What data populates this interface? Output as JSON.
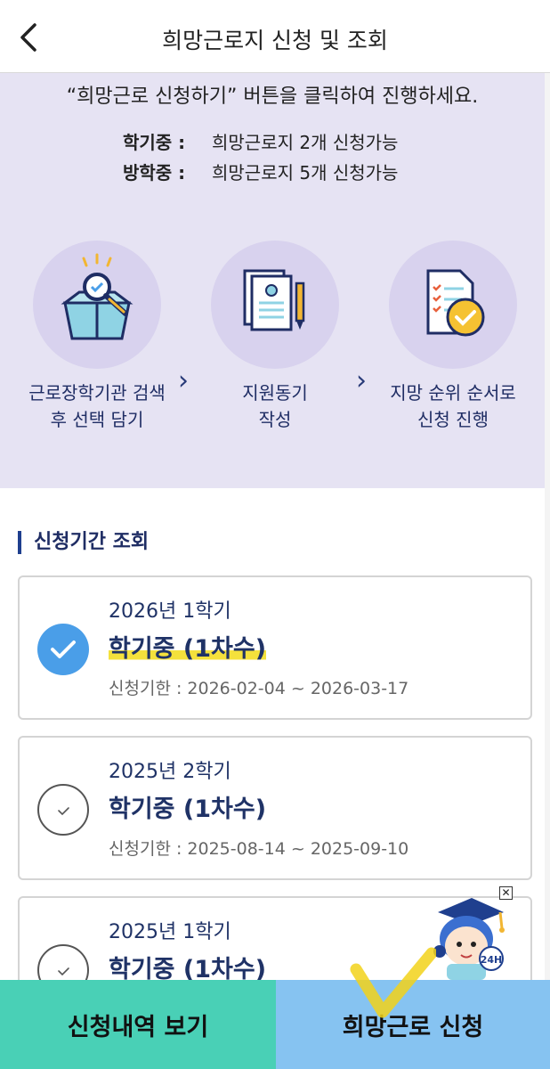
{
  "header": {
    "title": "희망근로지 신청 및 조회"
  },
  "info": {
    "message": "“희망근로 신청하기” 버튼을 클릭하여 진행하세요.",
    "capacity": [
      {
        "label": "학기중 :",
        "value": "희망근로지 2개 신청가능"
      },
      {
        "label": "방학중 :",
        "value": "희망근로지 5개 신청가능"
      }
    ],
    "steps": [
      {
        "icon": "search-box-icon",
        "label_line1": "근로장학기관 검색",
        "label_line2": "후 선택 담기"
      },
      {
        "icon": "document-pen-icon",
        "label_line1": "지원동기",
        "label_line2": "작성"
      },
      {
        "icon": "checklist-approved-icon",
        "label_line1": "지망 순위 순서로",
        "label_line2": "신청 진행"
      }
    ]
  },
  "section": {
    "title": "신청기간 조회"
  },
  "periods": [
    {
      "semester": "2026년 1학기",
      "phase": "학기중 (1차수)",
      "deadline": "신청기한 : 2026-02-04 ~ 2026-03-17",
      "selected": true
    },
    {
      "semester": "2025년 2학기",
      "phase": "학기중 (1차수)",
      "deadline": "신청기한 : 2025-08-14 ~ 2025-09-10",
      "selected": false
    },
    {
      "semester": "2025년 1학기",
      "phase": "학기중 (1차수)",
      "deadline": "",
      "selected": false
    }
  ],
  "mascot": {
    "badge": "24H"
  },
  "bottom": {
    "history_label": "신청내역 보기",
    "apply_label": "희망근로 신청"
  },
  "colors": {
    "accent": "#4a9ee8",
    "info_bg": "#e6e3f3",
    "history_btn": "#49d0b6",
    "apply_btn": "#86c3f1",
    "highlight": "#f4e13c",
    "navy": "#1f3266"
  }
}
